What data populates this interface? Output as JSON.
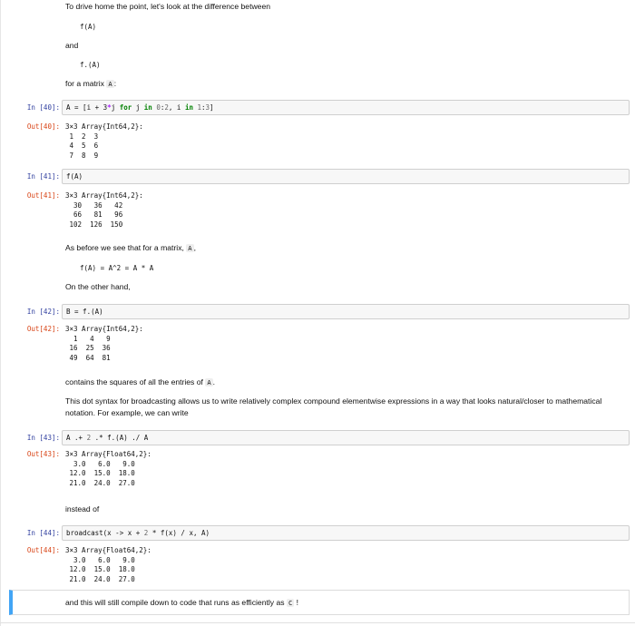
{
  "intro": {
    "line1": "To drive home the point, let's look at the difference between",
    "code_f": "f(A)",
    "and": "and",
    "code_fdot": "f.(A)",
    "for_matrix": "for a matrix",
    "code_A": "A",
    "colon": ":"
  },
  "cells": [
    {
      "in_prompt": "In [40]:",
      "out_prompt": "Out[40]:",
      "output": "3×3 Array{Int64,2}:\n 1  2  3\n 4  5  6\n 7  8  9"
    },
    {
      "in_prompt": "In [41]:",
      "input": "f(A)",
      "out_prompt": "Out[41]:",
      "output": "3×3 Array{Int64,2}:\n  30   36   42\n  66   81   96\n 102  126  150"
    },
    {
      "in_prompt": "In [42]:",
      "out_prompt": "Out[42]:",
      "output": "3×3 Array{Int64,2}:\n  1   4   9\n 16  25  36\n 49  64  81"
    },
    {
      "in_prompt": "In [43]:",
      "out_prompt": "Out[43]:",
      "output": "3×3 Array{Float64,2}:\n  3.0   6.0   9.0\n 12.0  15.0  18.0\n 21.0  24.0  27.0"
    },
    {
      "in_prompt": "In [44]:",
      "out_prompt": "Out[44]:",
      "output": "3×3 Array{Float64,2}:\n  3.0   6.0   9.0\n 12.0  15.0  18.0\n 21.0  24.0  27.0"
    }
  ],
  "cell40_code": {
    "p1": "A = [i + 3",
    "p2": "*",
    "p3": "j ",
    "kw_for": "for",
    "p4": " j ",
    "kw_in1": "in",
    "p5": " ",
    "n1": "0",
    "p6": ":",
    "n2": "2",
    "p7": ", i ",
    "kw_in2": "in",
    "p8": " ",
    "n3": "1",
    "p9": ":",
    "n4": "3",
    "p10": "]"
  },
  "cell42_code": {
    "p1": "B = f.(A)"
  },
  "cell43_code": {
    "p1": "A .+ ",
    "n1": "2",
    "p2": " .* f.(A) ./ A"
  },
  "cell44_code": {
    "p1": "broadcast(x -> x + ",
    "n1": "2",
    "p2": " * f(x) / x, A)"
  },
  "md2": {
    "before": "As before we see that for a matrix,",
    "code_A": "A",
    "comma": ",",
    "code_line": "f(A) = A^2 = A * A",
    "other_hand": "On the other hand,"
  },
  "md3": {
    "contains": "contains the squares of all the entries of",
    "code_A": "A",
    "period": ".",
    "dot_syntax": "This dot syntax for broadcasting allows us to write relatively complex compound elementwise expressions in a way that looks natural/closer to mathematical notation. For example, we can write"
  },
  "md4": {
    "instead": "instead of"
  },
  "md5": {
    "text": "and this will still compile down to code that runs as efficiently as",
    "code_C": "C",
    "bang": "!"
  }
}
